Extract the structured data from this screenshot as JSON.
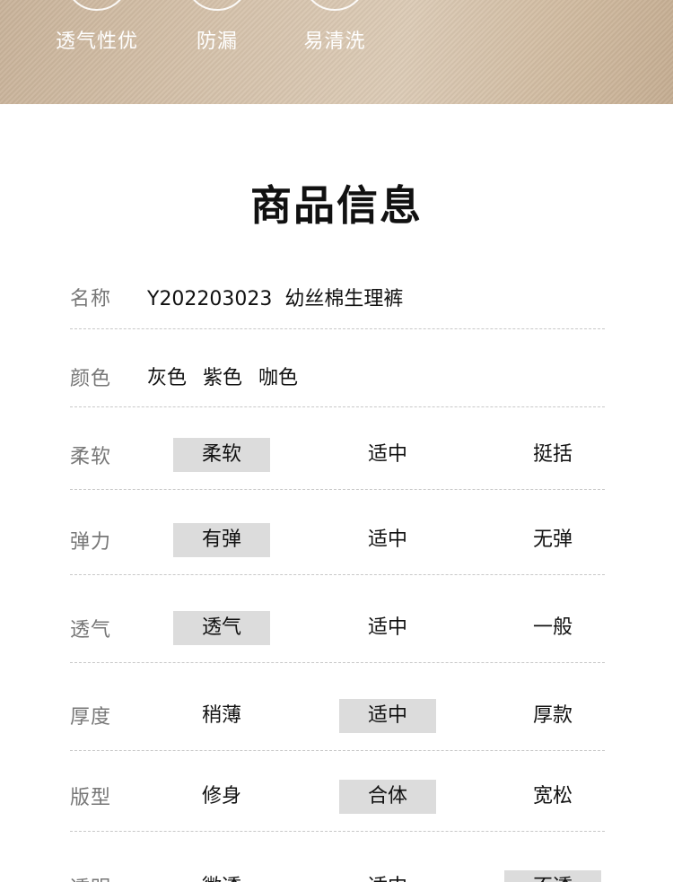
{
  "banner": {
    "features": [
      "透气性优",
      "防漏",
      "易清洗"
    ]
  },
  "section_title": "商品信息",
  "name_row": {
    "label": "名称",
    "value": "Y202203023  幼丝棉生理裤"
  },
  "color_row": {
    "label": "颜色",
    "values": [
      "灰色",
      "紫色",
      "咖色"
    ]
  },
  "attributes": [
    {
      "label": "柔软",
      "options": [
        "柔软",
        "适中",
        "挺括"
      ],
      "selected": 0
    },
    {
      "label": "弹力",
      "options": [
        "有弹",
        "适中",
        "无弹"
      ],
      "selected": 0
    },
    {
      "label": "透气",
      "options": [
        "透气",
        "适中",
        "一般"
      ],
      "selected": 0
    },
    {
      "label": "厚度",
      "options": [
        "稍薄",
        "适中",
        "厚款"
      ],
      "selected": 1
    },
    {
      "label": "版型",
      "options": [
        "修身",
        "合体",
        "宽松"
      ],
      "selected": 1
    },
    {
      "label": "透明",
      "options": [
        "微透",
        "适中",
        "不透"
      ],
      "selected": 2
    }
  ],
  "colors": {
    "selected_bg": "#dcdcdc",
    "label_gray": "#777777",
    "divider": "#c8c8c8"
  }
}
